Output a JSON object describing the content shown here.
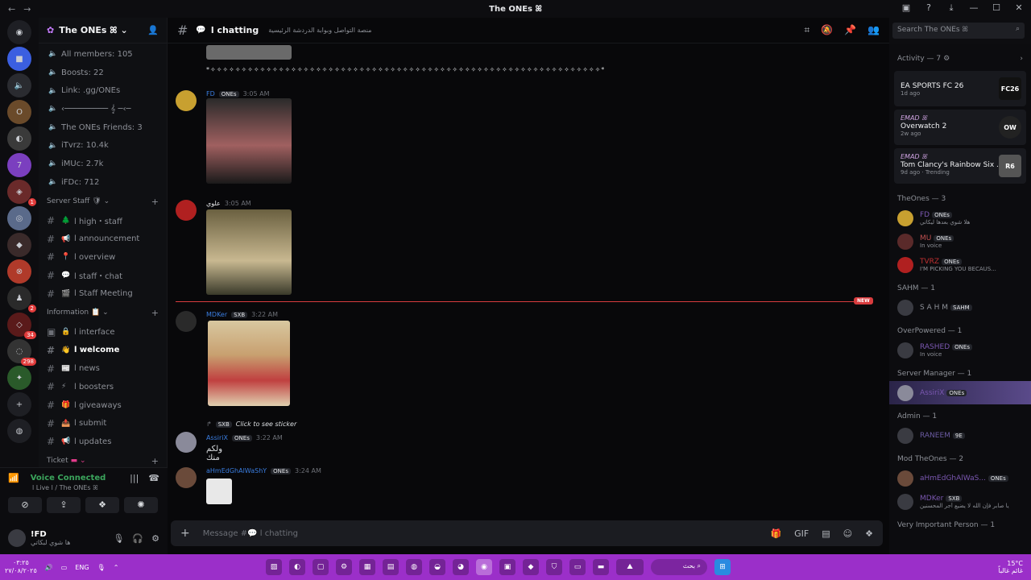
{
  "window": {
    "title": "The ONEs ꕤ"
  },
  "server": {
    "name": "The ONEs ꕤ"
  },
  "stats": [
    {
      "label": "All members: 105"
    },
    {
      "label": "Boosts: 22"
    },
    {
      "label": "Link: .gg/ONEs"
    },
    {
      "label": "‹───────── 𝄞 ─‹─"
    },
    {
      "label": "The ONEs Friends: 3"
    },
    {
      "label": "iTvrz: 10.4k"
    },
    {
      "label": "iMUc: 2.7k"
    },
    {
      "label": "iFDc: 712"
    }
  ],
  "categories": {
    "staff": "Server Staff",
    "info": "Information",
    "ticket": "Ticket"
  },
  "staff_channels": [
    {
      "label": "l high・staff",
      "emoji": "🌲"
    },
    {
      "label": "l announcement",
      "emoji": "📢"
    },
    {
      "label": "l overview",
      "emoji": "📍"
    },
    {
      "label": "l staff・chat",
      "emoji": "💬"
    },
    {
      "label": "l Staff Meeting",
      "emoji": "🎬"
    }
  ],
  "info_channels": [
    {
      "label": "l interface",
      "emoji": "🔒"
    },
    {
      "label": "l welcome",
      "emoji": "👋"
    },
    {
      "label": "l news",
      "emoji": "📰"
    },
    {
      "label": "l boosters",
      "emoji": "⚡"
    },
    {
      "label": "l giveaways",
      "emoji": "🎁"
    },
    {
      "label": "l submit",
      "emoji": "📤"
    },
    {
      "label": "l updates",
      "emoji": "📢"
    }
  ],
  "voice": {
    "status": "Voice Connected",
    "channel": "l Live l / The ONEs ꕤ"
  },
  "user": {
    "name": "!FD",
    "status": "ها شوي لبكاتي"
  },
  "chat": {
    "channel": "l chatting",
    "topic": "منصة التواصل وبوابة الدردشة الرئيسية",
    "composer_placeholder": "Message #💬 l chatting",
    "search_placeholder": "Search The ONEs ꕤ",
    "dots_line": "*✧✧✧✧✧✧✧✧✧✧✧✧✧✧✧✧✧✧✧✧✧✧✧✧✧✧✧✧✧✧✧✧✧✧✧✧✧✧✧✧✧✧✧✧✧✧✧✧✧✧✧✧✧✧✧✧✧✧✧✧✧✧✧*",
    "new_tag": "NEW",
    "messages": [
      {
        "user": "FD",
        "tag": "ONEs",
        "time": "3:05 AM"
      },
      {
        "user": "علوي",
        "tag": "",
        "time": "3:05 AM"
      },
      {
        "user": "MDKer",
        "tag": "SXB",
        "time": "3:22 AM"
      },
      {
        "user": "AssiriX",
        "tag": "ONEs",
        "time": "3:22 AM",
        "reply": "Click to see sticker",
        "text": "ولكم منك"
      },
      {
        "user": "aHmEdGhAlWaShY",
        "tag": "ONEs",
        "time": "3:24 AM"
      }
    ]
  },
  "activity": {
    "header": "Activity — 7",
    "cards": [
      {
        "who": "",
        "game": "EA SPORTS FC 26",
        "ago": "1d ago",
        "logo": "FC26"
      },
      {
        "who": "EMAD ꕤ",
        "game": "Overwatch 2",
        "ago": "2w ago",
        "logo": "OW"
      },
      {
        "who": "EMAD ꕤ",
        "game": "Tom Clancy's Rainbow Six ...",
        "ago": "9d ago · Trending",
        "logo": "R6"
      }
    ]
  },
  "member_groups": [
    {
      "label": "TheOnes — 3",
      "members": [
        {
          "name": "FD",
          "tag": "ONEs",
          "sub": "هلا شوي بعدها ليكاتي"
        },
        {
          "name": "MU",
          "tag": "ONEs",
          "sub": "In voice"
        },
        {
          "name": "TVRZ",
          "tag": "ONEs",
          "sub": "I'M PICKING YOU BECAUS..."
        }
      ]
    },
    {
      "label": "SAHM — 1",
      "members": [
        {
          "name": "S A H M",
          "tag": "SAHM",
          "sub": ""
        }
      ]
    },
    {
      "label": "OverPowered — 1",
      "members": [
        {
          "name": "RASHED",
          "tag": "ONEs",
          "sub": "In voice"
        }
      ]
    },
    {
      "label": "Server Manager — 1",
      "members": [
        {
          "name": "AssiriX",
          "tag": "ONEs",
          "sub": ""
        }
      ]
    },
    {
      "label": "Admin — 1",
      "members": [
        {
          "name": "RANEEM",
          "tag": "9E",
          "sub": ""
        }
      ]
    },
    {
      "label": "Mod TheOnes — 2",
      "members": [
        {
          "name": "aHmEdGhAlWaS...",
          "tag": "ONEs",
          "sub": ""
        },
        {
          "name": "MDKer",
          "tag": "SXB",
          "sub": "يا صابر فإن الله لا يضيع أجر المحسنين"
        }
      ]
    },
    {
      "label": "Very Important Person — 1",
      "members": []
    }
  ],
  "taskbar": {
    "lang": "ENG",
    "time": "٠٣:٢٥",
    "date": "٢٧/٠٨/٢٠٢٥",
    "search": "بحث",
    "weather": "15°C",
    "weather_desc": "غائم غالباً"
  }
}
